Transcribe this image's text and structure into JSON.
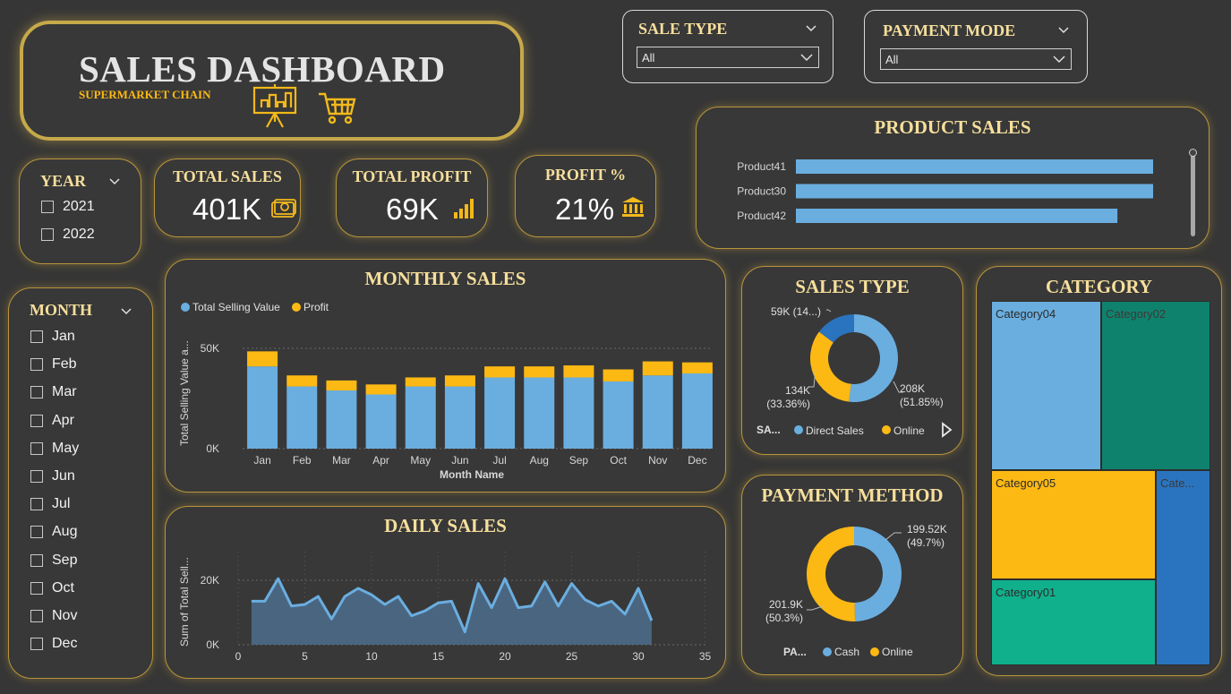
{
  "header": {
    "title": "SALES DASHBOARD",
    "subtitle": "SUPERMARKET CHAIN"
  },
  "sale_type_slicer": {
    "title": "SALE TYPE",
    "value": "All"
  },
  "payment_mode_slicer": {
    "title": "PAYMENT MODE",
    "value": "All"
  },
  "year_slicer": {
    "title": "YEAR",
    "items": [
      "2021",
      "2022"
    ]
  },
  "month_slicer": {
    "title": "MONTH",
    "items": [
      "Jan",
      "Feb",
      "Mar",
      "Apr",
      "May",
      "Jun",
      "Jul",
      "Aug",
      "Sep",
      "Oct",
      "Nov",
      "Dec"
    ]
  },
  "kpis": [
    {
      "title": "TOTAL SALES",
      "value": "401K",
      "icon": "cash-icon"
    },
    {
      "title": "TOTAL PROFIT",
      "value": "69K",
      "icon": "bar-signal-icon"
    },
    {
      "title": "PROFIT %",
      "value": "21%",
      "icon": "bank-icon"
    }
  ],
  "colors": {
    "accent": "#f6df9c",
    "blue": "#6aaee0",
    "gold": "#fdb913",
    "darkblue": "#2a74bf",
    "teal": "#0f8a6f",
    "green": "#11b08c"
  },
  "monthly": {
    "title": "MONTHLY SALES",
    "legend": [
      "Total Selling Value",
      "Profit"
    ],
    "ylabel": "Total Selling Value a...",
    "xlabel": "Month Name",
    "yticks": [
      "0K",
      "50K"
    ]
  },
  "daily": {
    "title": "DAILY SALES",
    "ylabel": "Sum of Total Sell...",
    "yticks": [
      "0K",
      "20K"
    ],
    "xticks": [
      "0",
      "5",
      "10",
      "15",
      "20",
      "25",
      "30",
      "35"
    ]
  },
  "product": {
    "title": "PRODUCT SALES"
  },
  "sales_type": {
    "title": "SALES TYPE",
    "legend_title": "SA...",
    "legend": [
      "Direct Sales",
      "Online"
    ],
    "labels": [
      "59K (14...)",
      "134K",
      "(33.36%)",
      "208K",
      "(51.85%)"
    ]
  },
  "payment": {
    "title": "PAYMENT METHOD",
    "legend_title": "PA...",
    "legend": [
      "Cash",
      "Online"
    ],
    "labels": [
      "199.52K",
      "(49.7%)",
      "201.9K",
      "(50.3%)"
    ]
  },
  "category": {
    "title": "CATEGORY",
    "labels": [
      "Category04",
      "Category02",
      "Category05",
      "Cate...",
      "Category01"
    ]
  },
  "chart_data": [
    {
      "type": "bar",
      "title": "MONTHLY SALES",
      "xlabel": "Month Name",
      "ylabel": "Total Selling Value a...",
      "categories": [
        "Jan",
        "Feb",
        "Mar",
        "Apr",
        "May",
        "Jun",
        "Jul",
        "Aug",
        "Sep",
        "Oct",
        "Nov",
        "Dec"
      ],
      "series": [
        {
          "name": "Total Selling Value",
          "values": [
            41,
            31,
            29,
            27,
            31,
            31,
            35.5,
            35.5,
            35.5,
            33.5,
            36.5,
            37.5
          ]
        },
        {
          "name": "Profit",
          "values": [
            7.5,
            5.5,
            5,
            5,
            4.5,
            5.5,
            5.5,
            5.5,
            6,
            6,
            7,
            5.5
          ]
        }
      ],
      "ylim": [
        0,
        60
      ],
      "grid": true,
      "legend": "top-left"
    },
    {
      "type": "area",
      "title": "DAILY SALES",
      "ylabel": "Sum of Total Sell...",
      "x": [
        1,
        2,
        3,
        4,
        5,
        6,
        7,
        8,
        9,
        10,
        11,
        12,
        13,
        14,
        15,
        16,
        17,
        18,
        19,
        20,
        21,
        22,
        23,
        24,
        25,
        26,
        27,
        28,
        29,
        30,
        31
      ],
      "values": [
        13.5,
        13.5,
        20.5,
        12,
        12.5,
        15,
        8,
        15,
        17.5,
        15.5,
        12.5,
        15,
        9,
        10.5,
        13,
        13.5,
        4,
        19,
        11.5,
        20.5,
        11.5,
        12,
        19.5,
        12,
        19,
        14,
        12,
        13.5,
        9.5,
        17.5,
        7.5
      ],
      "xlim": [
        0,
        35
      ],
      "ylim": [
        0,
        28
      ],
      "grid": true
    },
    {
      "type": "bar",
      "title": "PRODUCT SALES",
      "orientation": "horizontal",
      "categories": [
        "Product41",
        "Product30",
        "Product42"
      ],
      "values": [
        100,
        100,
        90
      ]
    },
    {
      "type": "pie",
      "title": "SALES TYPE",
      "donut": true,
      "labels": [
        "Direct Sales",
        "Online",
        "59K (14...)"
      ],
      "values": [
        208,
        134,
        59
      ],
      "percent": [
        51.85,
        33.36,
        14.79
      ]
    },
    {
      "type": "pie",
      "title": "PAYMENT METHOD",
      "donut": true,
      "labels": [
        "Cash",
        "Online"
      ],
      "values": [
        199.52,
        201.9
      ],
      "percent": [
        49.7,
        50.3
      ]
    },
    {
      "type": "heatmap",
      "title": "CATEGORY",
      "labels": [
        "Category04",
        "Category02",
        "Category05",
        "Cate...",
        "Category01"
      ],
      "values": [
        23.5,
        23.5,
        21.6,
        18.0,
        19.0
      ]
    }
  ]
}
